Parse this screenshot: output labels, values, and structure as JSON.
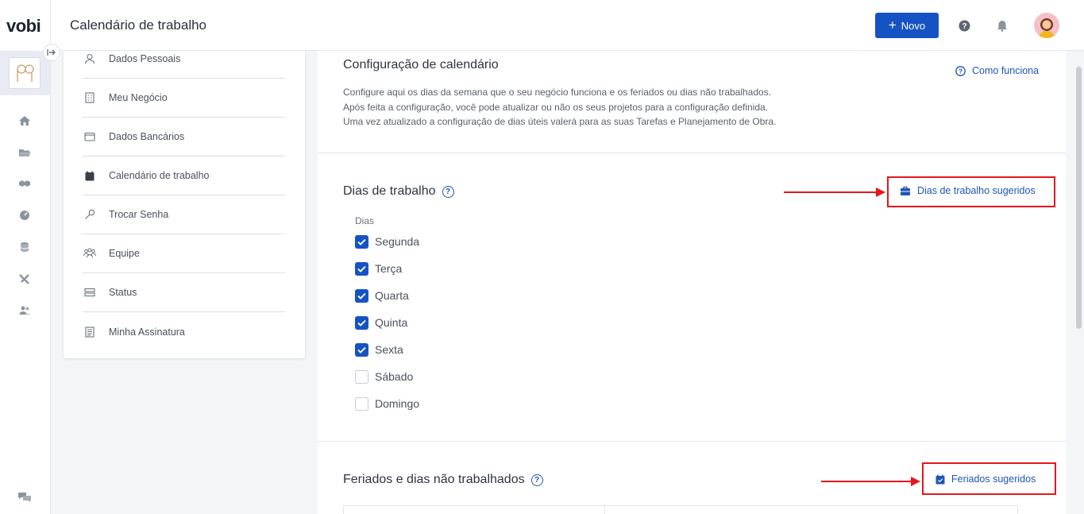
{
  "app": {
    "logo": "vobi",
    "page_title": "Calendário de trabalho"
  },
  "header": {
    "new_button_label": "Novo"
  },
  "settings_menu": {
    "items": [
      {
        "label": "Dados Pessoais",
        "icon": "user-icon"
      },
      {
        "label": "Meu Negócio",
        "icon": "building-icon"
      },
      {
        "label": "Dados Bancários",
        "icon": "wallet-icon"
      },
      {
        "label": "Calendário de trabalho",
        "icon": "calendar-icon"
      },
      {
        "label": "Trocar Senha",
        "icon": "key-icon"
      },
      {
        "label": "Equipe",
        "icon": "team-icon"
      },
      {
        "label": "Status",
        "icon": "status-icon"
      },
      {
        "label": "Minha Assinatura",
        "icon": "document-icon"
      }
    ]
  },
  "calendar_config": {
    "title": "Configuração de calendário",
    "help_link": "Como funciona",
    "description": [
      "Configure aqui os dias da semana que o seu negócio funciona e os feriados ou dias não trabalhados.",
      "Após feita a configuração, você pode atualizar ou não os seus projetos para a configuração definida.",
      "Uma vez atualizado a configuração de dias úteis valerá para as suas Tarefas e Planejamento de Obra."
    ]
  },
  "work_days": {
    "title": "Dias de trabalho",
    "suggested_button": "Dias de trabalho sugeridos",
    "days_label": "Dias",
    "days": [
      {
        "label": "Segunda",
        "checked": true
      },
      {
        "label": "Terça",
        "checked": true
      },
      {
        "label": "Quarta",
        "checked": true
      },
      {
        "label": "Quinta",
        "checked": true
      },
      {
        "label": "Sexta",
        "checked": true
      },
      {
        "label": "Sábado",
        "checked": false
      },
      {
        "label": "Domingo",
        "checked": false
      }
    ]
  },
  "holidays": {
    "title": "Feriados e dias não trabalhados",
    "suggested_button": "Feriados sugeridos"
  },
  "colors": {
    "primary": "#1553c4",
    "annotation_red": "#e8151b"
  }
}
